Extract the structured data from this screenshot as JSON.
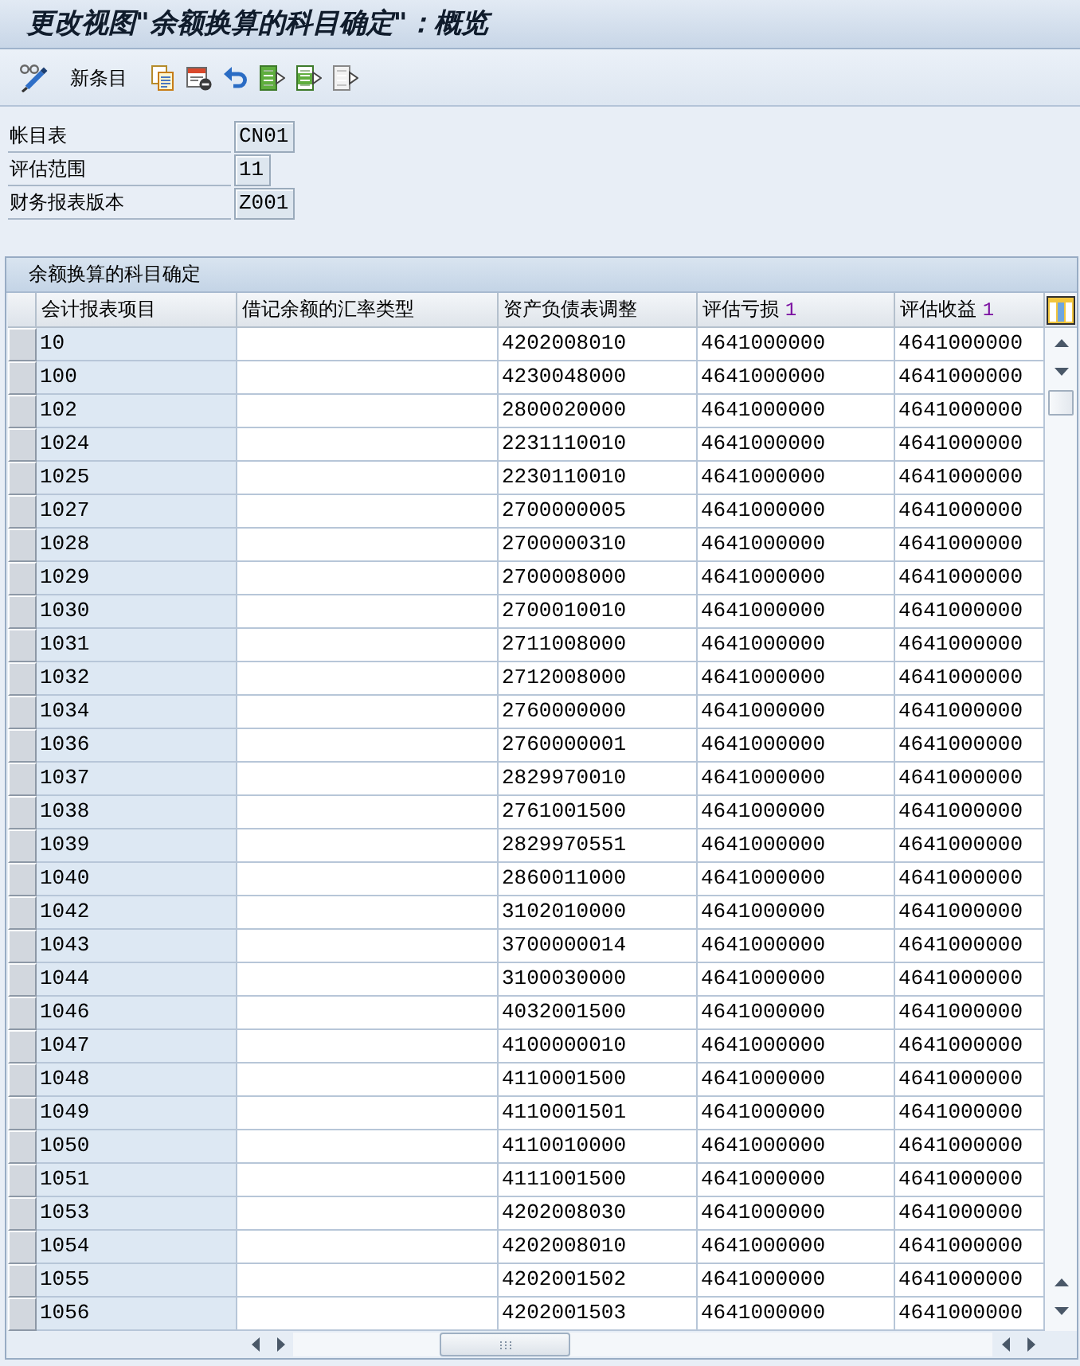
{
  "window": {
    "title": "更改视图\"余额换算的科目确定\"：概览"
  },
  "toolbar": [
    {
      "kind": "toggle"
    },
    {
      "kind": "new",
      "label": "新条目"
    },
    {
      "kind": "copy"
    },
    {
      "kind": "delete"
    },
    {
      "kind": "undo"
    },
    {
      "kind": "selectall"
    },
    {
      "kind": "selectblock"
    },
    {
      "kind": "deselectall"
    }
  ],
  "fields": [
    {
      "label": "帐目表",
      "value": "CN01"
    },
    {
      "label": "评估范围",
      "value": "11"
    },
    {
      "label": "财务报表版本",
      "value": "Z001"
    }
  ],
  "table": {
    "title": "余额换算的科目确定",
    "columns": [
      {
        "label": "会计报表项目"
      },
      {
        "label": "借记余额的汇率类型"
      },
      {
        "label": "资产负债表调整"
      },
      {
        "label": "评估亏损",
        "marker": "1"
      },
      {
        "label": "评估收益",
        "marker": "1"
      }
    ],
    "rows": [
      {
        "selected": false,
        "item": "10",
        "adjustment": "4202008010",
        "loss": "4641000000",
        "gain": "4641000000"
      },
      {
        "selected": false,
        "item": "100",
        "adjustment": "4230048000",
        "loss": "4641000000",
        "gain": "4641000000"
      },
      {
        "selected": false,
        "item": "102",
        "adjustment": "2800020000",
        "loss": "4641000000",
        "gain": "4641000000"
      },
      {
        "selected": false,
        "item": "1024",
        "adjustment": "2231110010",
        "loss": "4641000000",
        "gain": "4641000000"
      },
      {
        "selected": false,
        "item": "1025",
        "adjustment": "2230110010",
        "loss": "4641000000",
        "gain": "4641000000"
      },
      {
        "selected": false,
        "item": "1027",
        "adjustment": "2700000005",
        "loss": "4641000000",
        "gain": "4641000000"
      },
      {
        "selected": false,
        "item": "1028",
        "adjustment": "2700000310",
        "loss": "4641000000",
        "gain": "4641000000"
      },
      {
        "selected": false,
        "item": "1029",
        "adjustment": "2700008000",
        "loss": "4641000000",
        "gain": "4641000000"
      },
      {
        "selected": false,
        "item": "1030",
        "adjustment": "2700010010",
        "loss": "4641000000",
        "gain": "4641000000"
      },
      {
        "selected": false,
        "item": "1031",
        "adjustment": "2711008000",
        "loss": "4641000000",
        "gain": "4641000000"
      },
      {
        "selected": false,
        "item": "1032",
        "adjustment": "2712008000",
        "loss": "4641000000",
        "gain": "4641000000"
      },
      {
        "selected": false,
        "item": "1034",
        "adjustment": "2760000000",
        "loss": "4641000000",
        "gain": "4641000000"
      },
      {
        "selected": false,
        "item": "1036",
        "adjustment": "2760000001",
        "loss": "4641000000",
        "gain": "4641000000"
      },
      {
        "selected": false,
        "item": "1037",
        "adjustment": "2829970010",
        "loss": "4641000000",
        "gain": "4641000000"
      },
      {
        "selected": false,
        "item": "1038",
        "adjustment": "2761001500",
        "loss": "4641000000",
        "gain": "4641000000"
      },
      {
        "selected": false,
        "item": "1039",
        "adjustment": "2829970551",
        "loss": "4641000000",
        "gain": "4641000000"
      },
      {
        "selected": false,
        "item": "1040",
        "adjustment": "2860011000",
        "loss": "4641000000",
        "gain": "4641000000"
      },
      {
        "selected": false,
        "item": "1042",
        "adjustment": "3102010000",
        "loss": "4641000000",
        "gain": "4641000000"
      },
      {
        "selected": false,
        "item": "1043",
        "adjustment": "3700000014",
        "loss": "4641000000",
        "gain": "4641000000"
      },
      {
        "selected": false,
        "item": "1044",
        "adjustment": "3100030000",
        "loss": "4641000000",
        "gain": "4641000000"
      },
      {
        "selected": false,
        "item": "1046",
        "adjustment": "4032001500",
        "loss": "4641000000",
        "gain": "4641000000"
      },
      {
        "selected": false,
        "item": "1047",
        "adjustment": "4100000010",
        "loss": "4641000000",
        "gain": "4641000000"
      },
      {
        "selected": false,
        "item": "1048",
        "adjustment": "4110001500",
        "loss": "4641000000",
        "gain": "4641000000"
      },
      {
        "selected": false,
        "item": "1049",
        "adjustment": "4110001501",
        "loss": "4641000000",
        "gain": "4641000000"
      },
      {
        "selected": false,
        "item": "1050",
        "adjustment": "4110010000",
        "loss": "4641000000",
        "gain": "4641000000"
      },
      {
        "selected": false,
        "item": "1051",
        "adjustment": "4111001500",
        "loss": "4641000000",
        "gain": "4641000000"
      },
      {
        "selected": false,
        "item": "1053",
        "adjustment": "4202008030",
        "loss": "4641000000",
        "gain": "4641000000"
      },
      {
        "selected": false,
        "item": "1054",
        "adjustment": "4202008010",
        "loss": "4641000000",
        "gain": "4641000000"
      },
      {
        "selected": false,
        "item": "1055",
        "adjustment": "4202001502",
        "loss": "4641000000",
        "gain": "4641000000"
      },
      {
        "selected": false,
        "item": "1056",
        "adjustment": "4202001503",
        "loss": "4641000000",
        "gain": "4641000000"
      }
    ]
  }
}
